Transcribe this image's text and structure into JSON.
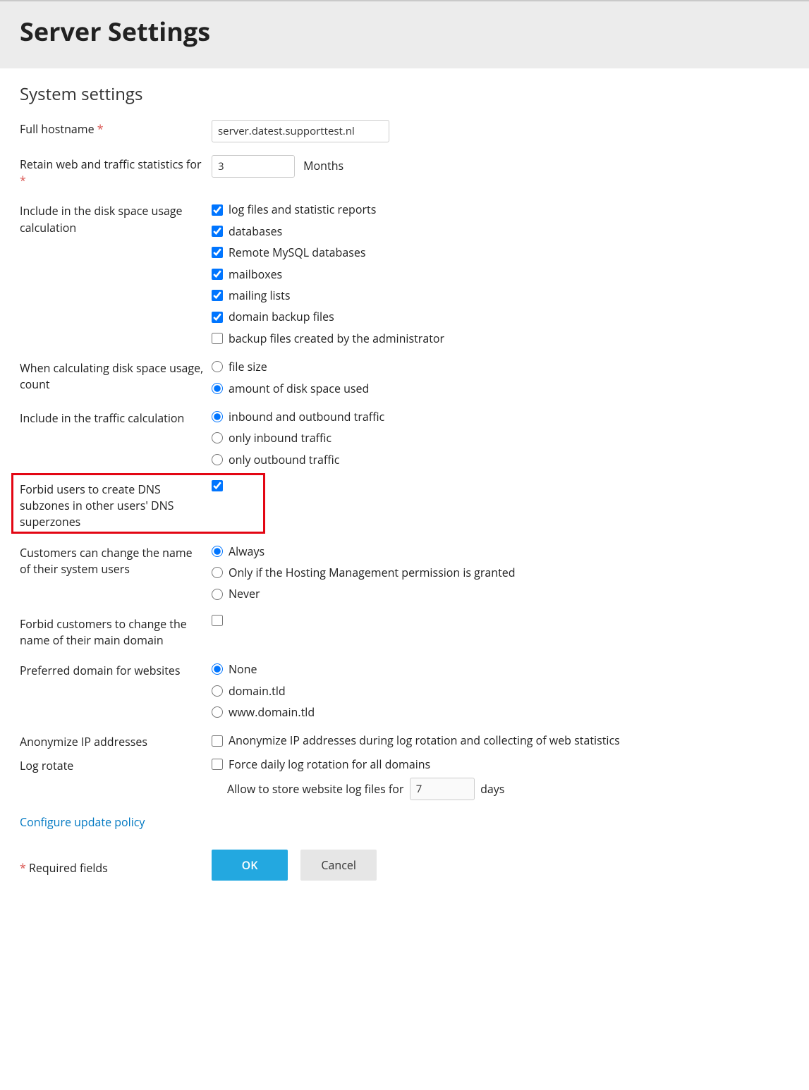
{
  "page_title": "Server Settings",
  "section_title": "System settings",
  "labels": {
    "hostname": "Full hostname",
    "retain": "Retain web and traffic statistics for",
    "months": "Months",
    "disk_include": "Include in the disk space usage calculation",
    "disk_count": "When calculating disk space usage, count",
    "traffic_include": "Include in the traffic calculation",
    "forbid_subzones": "Forbid users to create DNS subzones in other users' DNS superzones",
    "sysuser_change": "Customers can change the name of their system users",
    "forbid_main_domain": "Forbid customers to change the name of their main domain",
    "preferred_domain": "Preferred domain for websites",
    "anonymize": "Anonymize IP addresses",
    "logrotate": "Log rotate",
    "logrotate_allow": "Allow to store website log files for",
    "days": "days",
    "update_policy": "Configure update policy",
    "required": "Required fields",
    "ok": "OK",
    "cancel": "Cancel"
  },
  "values": {
    "hostname": "server.datest.supporttest.nl",
    "retain_months": "3",
    "log_days": "7"
  },
  "disk_include_opts": {
    "logfiles": "log files and statistic reports",
    "databases": "databases",
    "remote_mysql": "Remote MySQL databases",
    "mailboxes": "mailboxes",
    "mailinglists": "mailing lists",
    "domain_backup": "domain backup files",
    "admin_backup": "backup files created by the administrator"
  },
  "disk_count_opts": {
    "filesize": "file size",
    "diskused": "amount of disk space used"
  },
  "traffic_opts": {
    "both": "inbound and outbound traffic",
    "inbound": "only inbound traffic",
    "outbound": "only outbound traffic"
  },
  "sysuser_opts": {
    "always": "Always",
    "perm": "Only if the Hosting Management permission is granted",
    "never": "Never"
  },
  "preferred_opts": {
    "none": "None",
    "domain": "domain.tld",
    "www": "www.domain.tld"
  },
  "anonymize_label": "Anonymize IP addresses during log rotation and collecting of web statistics",
  "logrotate_force": "Force daily log rotation for all domains"
}
